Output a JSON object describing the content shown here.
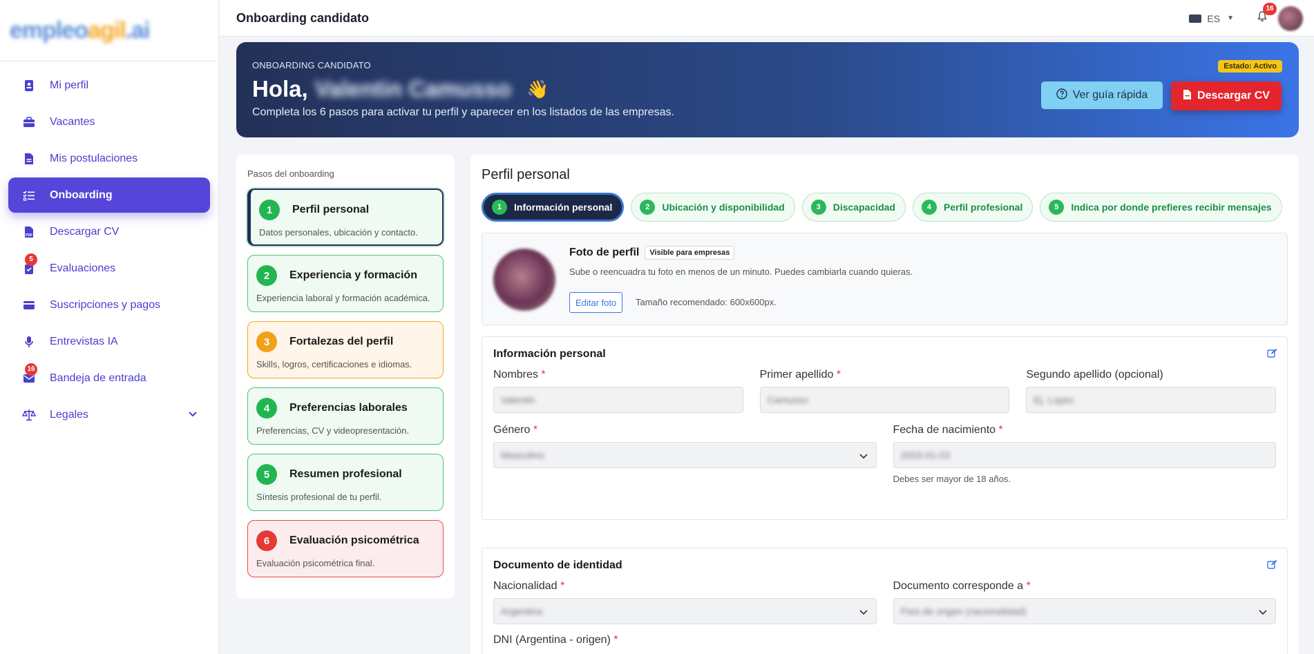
{
  "logo": {
    "part1": "empleo",
    "part2": "agil",
    "part3": ".ai"
  },
  "sidebar": {
    "items": [
      {
        "label": "Mi perfil",
        "icon": "id-badge-icon"
      },
      {
        "label": "Vacantes",
        "icon": "briefcase-icon"
      },
      {
        "label": "Mis postulaciones",
        "icon": "file-icon"
      },
      {
        "label": "Onboarding",
        "icon": "checklist-icon",
        "active": true
      },
      {
        "label": "Descargar CV",
        "icon": "pdf-icon"
      },
      {
        "label": "Evaluaciones",
        "icon": "clipboard-check-icon",
        "badge": "5"
      },
      {
        "label": "Suscripciones y pagos",
        "icon": "credit-card-icon"
      },
      {
        "label": "Entrevistas IA",
        "icon": "microphone-icon"
      },
      {
        "label": "Bandeja de entrada",
        "icon": "inbox-icon",
        "badge": "16"
      },
      {
        "label": "Legales",
        "icon": "scale-icon"
      }
    ]
  },
  "topbar": {
    "title": "Onboarding candidato",
    "lang": "ES",
    "notifications": "16"
  },
  "hero": {
    "kicker": "ONBOARDING CANDIDATO",
    "hello": "Hola,",
    "name": "Valentin Camusso",
    "wave": "👋",
    "subtitle": "Completa los 6 pasos para activar tu perfil y aparecer en los listados de las empresas.",
    "status": "Estado: Activo",
    "guide_button": "Ver guía rápida",
    "cv_button": "Descargar CV"
  },
  "steps": {
    "title": "Pasos del onboarding",
    "items": [
      {
        "num": "1",
        "title": "Perfil personal",
        "desc": "Datos personales, ubicación y contacto."
      },
      {
        "num": "2",
        "title": "Experiencia y formación",
        "desc": "Experiencia laboral y formación académica."
      },
      {
        "num": "3",
        "title": "Fortalezas del perfil",
        "desc": "Skills, logros, certificaciones e idiomas."
      },
      {
        "num": "4",
        "title": "Preferencias laborales",
        "desc": "Preferencias, CV y videopresentación."
      },
      {
        "num": "5",
        "title": "Resumen profesional",
        "desc": "Síntesis profesional de tu perfil."
      },
      {
        "num": "6",
        "title": "Evaluación psicométrica",
        "desc": "Evaluación psicométrica final."
      }
    ]
  },
  "main": {
    "title": "Perfil personal",
    "tabs": [
      {
        "num": "1",
        "label": "Información personal"
      },
      {
        "num": "2",
        "label": "Ubicación y disponibilidad"
      },
      {
        "num": "3",
        "label": "Discapacidad"
      },
      {
        "num": "4",
        "label": "Perfil profesional"
      },
      {
        "num": "5",
        "label": "Indica por donde prefieres recibir mensajes"
      }
    ],
    "photo": {
      "title": "Foto de perfil",
      "badge": "Visible para empresas",
      "desc": "Sube o reencuadra tu foto en menos de un minuto. Puedes cambiarla cuando quieras.",
      "edit_button": "Editar foto",
      "size_hint": "Tamaño recomendado: 600x600px."
    },
    "personal": {
      "title": "Información personal",
      "nombres_label": "Nombres",
      "nombres_value": "Valentin",
      "apellido1_label": "Primer apellido",
      "apellido1_value": "Camusso",
      "apellido2_label": "Segundo apellido (opcional)",
      "apellido2_placeholder": "Ej. Lopez",
      "genero_label": "Género",
      "genero_value": "Masculino",
      "fecha_label": "Fecha de nacimiento",
      "fecha_value": "2003-01-03",
      "fecha_hint": "Debes ser mayor de 18 años."
    },
    "documento": {
      "title": "Documento de identidad",
      "nacionalidad_label": "Nacionalidad",
      "nacionalidad_value": "Argentina",
      "corresponde_label": "Documento corresponde a",
      "corresponde_value": "País de origen (nacionalidad)",
      "dni_label": "DNI (Argentina - origen)"
    }
  }
}
